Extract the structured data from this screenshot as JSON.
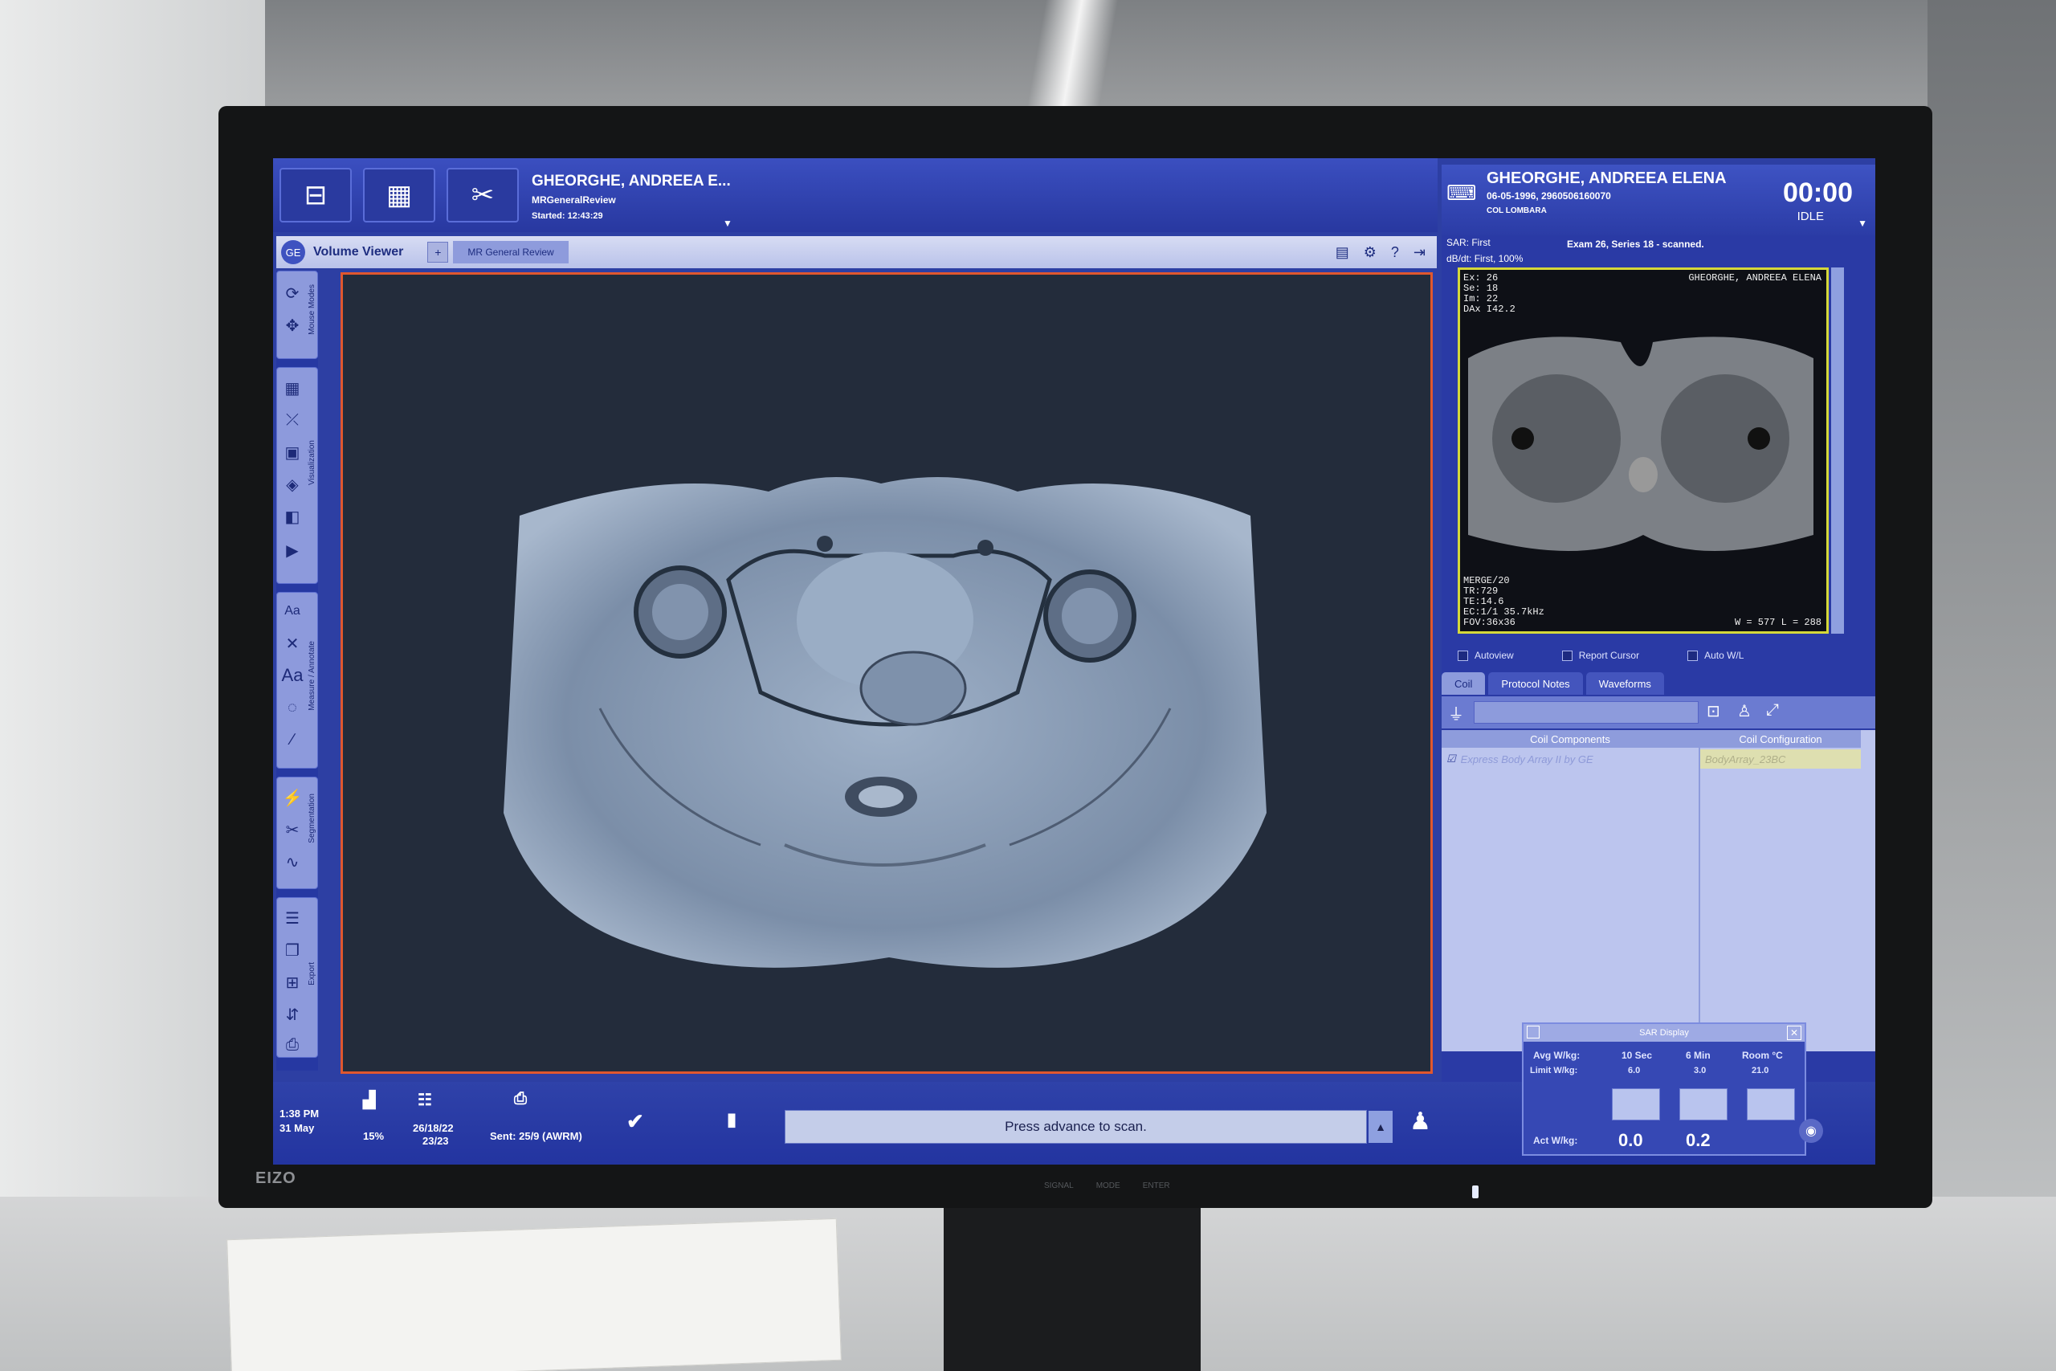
{
  "topbar": {
    "patient_name_short": "GHEORGHE, ANDREEA E...",
    "protocol": "MRGeneralReview",
    "started": "Started: 12:43:29"
  },
  "viewer": {
    "title": "Volume Viewer",
    "tab": "MR General Review"
  },
  "tool_groups": [
    "Mouse Modes",
    "Visualization",
    "Measure / Annotate",
    "Segmentation",
    "Export"
  ],
  "status": {
    "time": "1:38 PM",
    "date": "31 May",
    "percent": "15%",
    "counts_1": "26/18/22",
    "counts_2": "23/23",
    "sent": "Sent: 25/9 (AWRM)",
    "message": "Press advance to scan."
  },
  "right_panel": {
    "patient_name": "GHEORGHE, ANDREEA ELENA",
    "dob_id": "06-05-1996, 2960506160070",
    "exam_desc": "COL LOMBARA",
    "clock": "00:00",
    "state": "IDLE",
    "sar": "SAR: First",
    "dbdt": "dB/dt: First, 100%",
    "scan_status": "Exam 26, Series 18 -  scanned.",
    "thumb_overlay": {
      "tl": [
        "Ex: 26",
        "Se: 18",
        "Im: 22",
        "DAx I42.2"
      ],
      "tr": "GHEORGHE, ANDREEA ELENA",
      "bl": [
        "MERGE/20",
        "TR:729",
        "TE:14.6",
        "EC:1/1 35.7kHz",
        "FOV:36x36"
      ],
      "br": "W =   577 L =   288"
    },
    "checkboxes": [
      "Autoview",
      "Report Cursor",
      "Auto W/L"
    ],
    "tabs": [
      "Coil",
      "Protocol Notes",
      "Waveforms"
    ],
    "coil_headers": [
      "Coil Components",
      "Coil Configuration"
    ],
    "coil_component": "Express Body Array II by GE",
    "coil_config": "BodyArray_23BC"
  },
  "sar_display": {
    "title": "SAR Display",
    "headers": [
      "Avg W/kg:",
      "10 Sec",
      "6 Min",
      "Room °C"
    ],
    "limit_label": "Limit W/kg:",
    "limits": [
      "6.0",
      "3.0",
      "21.0"
    ],
    "act_label": "Act W/kg:",
    "act_values": [
      "0.0",
      "0.2"
    ]
  },
  "monitor_brand": "EIZO",
  "monitor_buttons": [
    "SIGNAL",
    "MODE",
    "ENTER"
  ],
  "colors": {
    "ui_blue": "#2d3fa3",
    "viewport_border": "#e0572e",
    "thumb_border": "#d5d83a"
  }
}
